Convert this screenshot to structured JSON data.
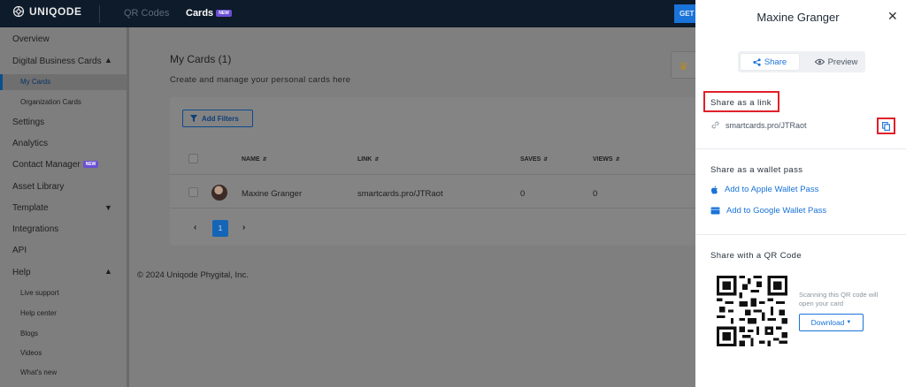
{
  "topbar": {
    "brand": "UNIQODE",
    "tab_qr": "QR Codes",
    "tab_cards": "Cards",
    "tab_cards_badge": "NEW",
    "cta_label": "GET"
  },
  "sidebar": {
    "overview": "Overview",
    "digital_business_cards": "Digital Business Cards",
    "my_cards": "My Cards",
    "organization_cards": "Organization Cards",
    "settings": "Settings",
    "analytics": "Analytics",
    "contact_manager": "Contact Manager",
    "contact_manager_badge": "NEW",
    "asset_library": "Asset Library",
    "template": "Template",
    "integrations": "Integrations",
    "api": "API",
    "help": "Help",
    "live_support": "Live support",
    "help_center": "Help center",
    "blogs": "Blogs",
    "videos": "Videos",
    "whats_new": "What's new"
  },
  "main": {
    "title": "My Cards (1)",
    "subtitle": "Create and manage your personal cards here",
    "add_filters": "Add Filters",
    "columns": {
      "name": "NAME",
      "link": "LINK",
      "saves": "SAVES",
      "views": "VIEWS"
    },
    "rows": [
      {
        "name": "Maxine Granger",
        "link": "smartcards.pro/JTRaot",
        "saves": "0",
        "views": "0"
      }
    ],
    "current_page": "1",
    "footer": "© 2024 Uniqode Phygital, Inc."
  },
  "drawer": {
    "title": "Maxine Granger",
    "tab_share": "Share",
    "tab_preview": "Preview",
    "share_link_heading": "Share as a link",
    "share_link_url": "smartcards.pro/JTRaot",
    "wallet_heading": "Share as a wallet pass",
    "apple_wallet": "Add to Apple Wallet Pass",
    "google_wallet": "Add to Google Wallet Pass",
    "qr_heading": "Share with a QR Code",
    "qr_note": "Scanning this QR code will open your card",
    "download_label": "Download"
  },
  "colors": {
    "accent": "#1a73d9",
    "highlight": "#e0202a",
    "topbar": "#0d1b2a"
  }
}
